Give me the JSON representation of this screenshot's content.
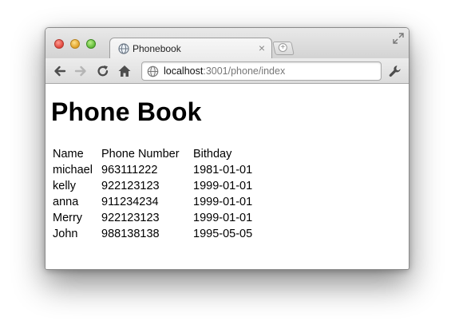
{
  "browser": {
    "tab_title": "Phonebook",
    "tab_close_glyph": "×",
    "url_host": "localhost",
    "url_rest": ":3001/phone/index",
    "icons": {
      "back": "back-arrow-icon",
      "forward": "forward-arrow-icon",
      "reload": "reload-icon",
      "home": "home-icon",
      "page": "globe-icon",
      "settings": "wrench-icon",
      "new_tab": "new-tab-icon",
      "fullscreen": "fullscreen-icon"
    },
    "colors": {
      "close": "#e0443a",
      "minimize": "#e0a126",
      "maximize": "#5fb936"
    }
  },
  "page": {
    "title": "Phone Book",
    "table": {
      "headers": [
        "Name",
        "Phone Number",
        "Bithday"
      ],
      "rows": [
        [
          "michael",
          "963111222",
          "1981-01-01"
        ],
        [
          "kelly",
          "922123123",
          "1999-01-01"
        ],
        [
          "anna",
          "911234234",
          "1999-01-01"
        ],
        [
          "Merry",
          "922123123",
          "1999-01-01"
        ],
        [
          "John",
          "988138138",
          "1995-05-05"
        ]
      ]
    }
  }
}
